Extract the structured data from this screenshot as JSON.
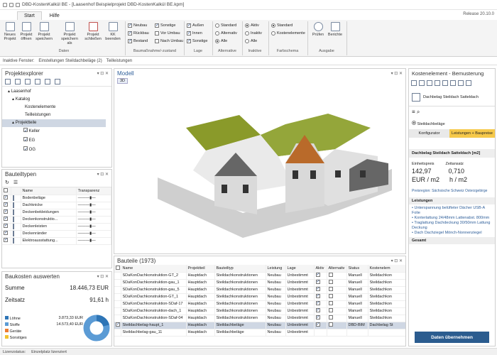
{
  "app": {
    "title": "DBD-KostenKalkül BE - [Laasenhof Beispielprojekt DBD-KostenKalkül BE.kpm]",
    "release": "Release 20.10.0"
  },
  "tabs": [
    "Start",
    "Hilfe"
  ],
  "ribbon": {
    "buttons": [
      {
        "label": "Neues Projekt"
      },
      {
        "label": "Projekt öffnen"
      },
      {
        "label": "Projekt speichern"
      },
      {
        "label": "Projekt speichern als"
      },
      {
        "label": "Projekt schließen"
      },
      {
        "label": "KK beenden"
      }
    ],
    "group_data": "Daten",
    "baumassnahme": {
      "items": [
        {
          "label": "Neubau",
          "on": true
        },
        {
          "label": "Sonstige",
          "on": true
        },
        {
          "label": "Rückbau",
          "on": true
        },
        {
          "label": "Vor Umbau",
          "on": false
        },
        {
          "label": "Bestand",
          "on": true
        },
        {
          "label": "Nach Umbau",
          "on": false
        }
      ],
      "group": "Baumaßnahme/-zustand"
    },
    "lage": {
      "items": [
        {
          "label": "Außen",
          "on": true
        },
        {
          "label": "Innen",
          "on": true
        },
        {
          "label": "Sonstige",
          "on": true
        }
      ],
      "group": "Lage"
    },
    "alternative": {
      "items": [
        {
          "label": "Standard",
          "on": false
        },
        {
          "label": "Alternativ",
          "on": false
        },
        {
          "label": "Alle",
          "on": true
        }
      ],
      "group": "Alternative"
    },
    "inaktive": {
      "items": [
        {
          "label": "Aktiv",
          "on": true
        },
        {
          "label": "Inaktiv",
          "on": false
        },
        {
          "label": "Alle",
          "on": false
        }
      ],
      "group": "Inaktive"
    },
    "farbschema": {
      "items": [
        {
          "label": "Standard",
          "on": true
        },
        {
          "label": "Kostenelemente",
          "on": false
        }
      ],
      "group": "Farbschema"
    },
    "ausgabe": {
      "items": [
        {
          "label": "Prüfen"
        },
        {
          "label": "Berichte"
        }
      ],
      "group": "Ausgabe"
    }
  },
  "status_line": [
    "Inaktive Fenster:",
    "Einstellungen Steildachbeläge (2)",
    "Teilleistungen"
  ],
  "projektexplorer": {
    "title": "Projektexplorer",
    "tree": [
      "Laasenhof",
      "Katalog",
      "Kostenelemente",
      "Teilleistungen",
      "Projektteile",
      "Keller",
      "EG",
      "OG"
    ]
  },
  "bauteiltypen": {
    "title": "Bauteiltypen",
    "headers": [
      "Name",
      "Transparenz"
    ],
    "rows": [
      "Bodenbeläge",
      "Dachknicke",
      "Deckenbekleidungen",
      "Deckenkonstruktio...",
      "Deckenleisten",
      "Deckenränder",
      "Elektroausstattung..."
    ]
  },
  "baukosten": {
    "title": "Baukosten auswerten",
    "summe_label": "Summe",
    "summe_value": "18.446,73 EUR",
    "zeitsatz_label": "Zeitsatz",
    "zeitsatz_value": "91,61 h",
    "items": [
      {
        "label": "Löhne",
        "value": "3.873,33 EUR",
        "color": "#2e75b6"
      },
      {
        "label": "Stoffe",
        "value": "14.573,40 EUR",
        "color": "#5b9bd5"
      },
      {
        "label": "Geräte",
        "value": "",
        "color": "#ed7d31"
      },
      {
        "label": "Sonstiges",
        "value": "",
        "color": "#f2c12e"
      }
    ]
  },
  "model": {
    "title": "Modell",
    "tab": "3D"
  },
  "bauteile": {
    "title": "Bauteile (1973)",
    "headers": [
      "Name",
      "Projektteil",
      "Bauteiltyp",
      "Leistung",
      "Lage",
      "Aktiv",
      "Alternativ",
      "Status",
      "Kostenelem"
    ],
    "rows": [
      [
        "SDaKonDachkonstruktion-GT_2",
        "Hauptdach",
        "Steildachkonstruktionen",
        "Neubau",
        "Unbestimmt",
        "Manuell",
        "Steildachkon"
      ],
      [
        "SDaKonDachkonstruktion-gau_1",
        "Hauptdach",
        "Steildachkonstruktionen",
        "Neubau",
        "Unbestimmt",
        "Manuell",
        "Steildachkon"
      ],
      [
        "SDaKonDachkonstruktion-gau_5",
        "Hauptdach",
        "Steildachkonstruktionen",
        "Neubau",
        "Unbestimmt",
        "Manuell",
        "Steildachkon"
      ],
      [
        "SDaKonDachkonstruktion-GT_1",
        "Hauptdach",
        "Steildachkonstruktionen",
        "Neubau",
        "Unbestimmt",
        "Manuell",
        "Steildachkon"
      ],
      [
        "SDaKonDachkonstruktion-SDaf-17",
        "Hauptdach",
        "Steildachkonstruktionen",
        "Neubau",
        "Unbestimmt",
        "Manuell",
        "Steildachkon"
      ],
      [
        "SDaKonDachkonstruktion-dach_1",
        "Hauptdach",
        "Steildachkonstruktionen",
        "Neubau",
        "Unbestimmt",
        "Manuell",
        "Steildachkon"
      ],
      [
        "SDaKonDachkonstruktion-SDaf-04",
        "Hauptdach",
        "Steildachkonstruktionen",
        "Neubau",
        "Unbestimmt",
        "Manuell",
        "Steildachkon"
      ],
      [
        "Steildachbelag-haupt_1",
        "Hauptdach",
        "Steildachbeläge",
        "Neubau",
        "Unbestimmt",
        "DBD-BIM",
        "Dachbelag St"
      ],
      [
        "Steildachbelag-gau_11",
        "Hauptdach",
        "Steildachbeläge",
        "Neubau",
        "Unbestimmt",
        "",
        ""
      ]
    ]
  },
  "kostenelement": {
    "title": "Kostenelement - Bemusterung",
    "element": "Dachbelag Steildach Satteldach",
    "option": "Steildachbeläge",
    "tab1": "Konfigurator",
    "tab2": "Leistungen + Baupreise",
    "header": "Dachbelag Steildach Satteldach [m2]",
    "ep_label": "Einheitspreis",
    "ep_value": "142,97",
    "ep_unit": "EUR / m2",
    "zs_label": "Zeitansatz",
    "zs_value": "0,710",
    "zs_unit": "h / m2",
    "region": "Preisregion: Sächsische Schweiz Osterzgebirge",
    "leistungen_label": "Leistungen",
    "leistungen": [
      "Unterspannung belüfteter Dächer USB-A Folie",
      "Konterlattung 24/48mm Lattenabst. 800mm",
      "Traglattung Dachdeckung 30/50mm Lattung Deckung",
      "Dach Dachziegel Mönch-Nonnenziegel"
    ],
    "gesamt": "Gesamt",
    "button": "Daten übernehmen"
  },
  "footer": [
    "Lizenzstatus:",
    "Einzelplatz lizenziert"
  ]
}
